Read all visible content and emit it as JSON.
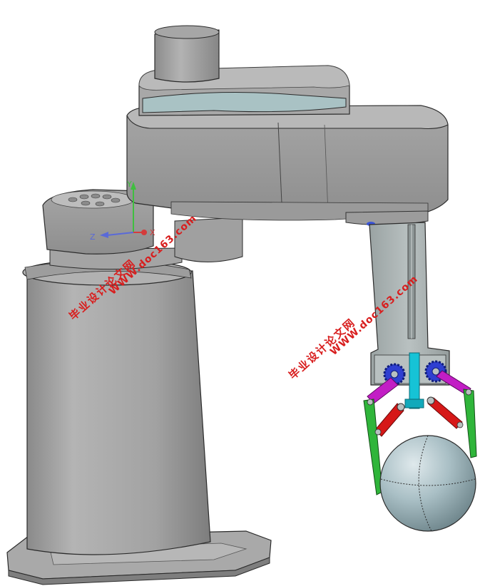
{
  "watermarks": {
    "url": "WWW.doc163.com",
    "site_name": "毕业设计论文网"
  },
  "axis_labels": {
    "y": "Y",
    "z": "Z",
    "x": "X"
  },
  "colors": {
    "metal": "#9a9a9a",
    "metal_dark": "#7c7c7c",
    "metal_light": "#bdbdbd",
    "accent_band": "#a9c2c4",
    "gear": "#2f3fd1",
    "rack": "#16c3d6",
    "link_magenta": "#c21ec5",
    "link_red": "#d61818",
    "finger_green": "#2fb53a",
    "ball": "#9fb7be",
    "watermark": "#d81e1e"
  }
}
